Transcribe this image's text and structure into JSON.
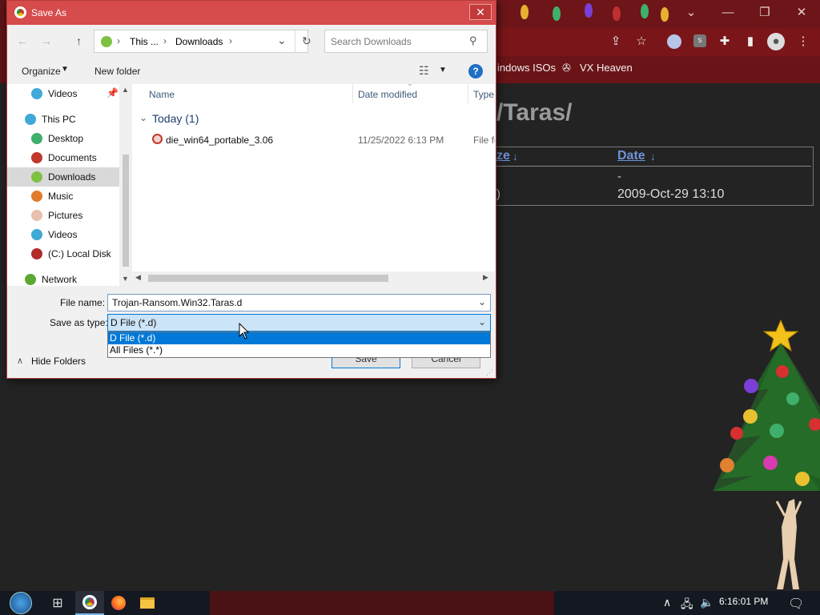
{
  "browser": {
    "bookmarks": [
      "indows ISOs",
      "VX Heaven"
    ],
    "page_heading": "/Taras/",
    "table": {
      "col_size": "ze",
      "col_date": "Date",
      "row1_date": "-",
      "row2_size": ")",
      "row2_date": "2009-Oct-29 13:10"
    },
    "window_controls": {
      "chevron": "⌄",
      "minimize": "—",
      "maximize": "❐",
      "close": "✕"
    }
  },
  "dialog": {
    "title": "Save As",
    "close_label": "✕",
    "breadcrumb": {
      "root_sep": "›",
      "item1": "This ...",
      "sep": "›",
      "item2": "Downloads",
      "sep2": "›"
    },
    "search_placeholder": "Search Downloads",
    "toolbar": {
      "organize": "Organize",
      "new_folder": "New folder"
    },
    "nav_items": [
      {
        "label": "Videos",
        "color": "#3fa9d8"
      },
      {
        "label": "This PC",
        "color": "#3fa9d8"
      },
      {
        "label": "Desktop",
        "color": "#3fb06b"
      },
      {
        "label": "Documents",
        "color": "#c0392b"
      },
      {
        "label": "Downloads",
        "color": "#7cc142"
      },
      {
        "label": "Music",
        "color": "#e07b2b"
      },
      {
        "label": "Pictures",
        "color": "#e8c0b0"
      },
      {
        "label": "Videos",
        "color": "#3fa9d8"
      },
      {
        "label": "(C:) Local Disk",
        "color": "#b22a2a"
      },
      {
        "label": "Network",
        "color": "#5aa832"
      }
    ],
    "columns": {
      "name": "Name",
      "date": "Date modified",
      "type": "Type"
    },
    "group": {
      "label": "Today (1)"
    },
    "files": [
      {
        "name": "die_win64_portable_3.06",
        "date": "11/25/2022 6:13 PM",
        "type": "File fo"
      }
    ],
    "filename_label": "File name:",
    "filename_value": "Trojan-Ransom.Win32.Taras.d",
    "savetype_label": "Save as type:",
    "savetype_value": "D File (*.d)",
    "type_options": [
      "D File (*.d)",
      "All Files (*.*)"
    ],
    "hide_folders": "Hide Folders",
    "save_label": "Save",
    "cancel_label": "Cancel"
  },
  "taskbar": {
    "time": "6:16:01 PM"
  },
  "colors": {
    "accent": "#0078d7",
    "titlebar": "#d64b4b",
    "browser": "#6d1518"
  }
}
